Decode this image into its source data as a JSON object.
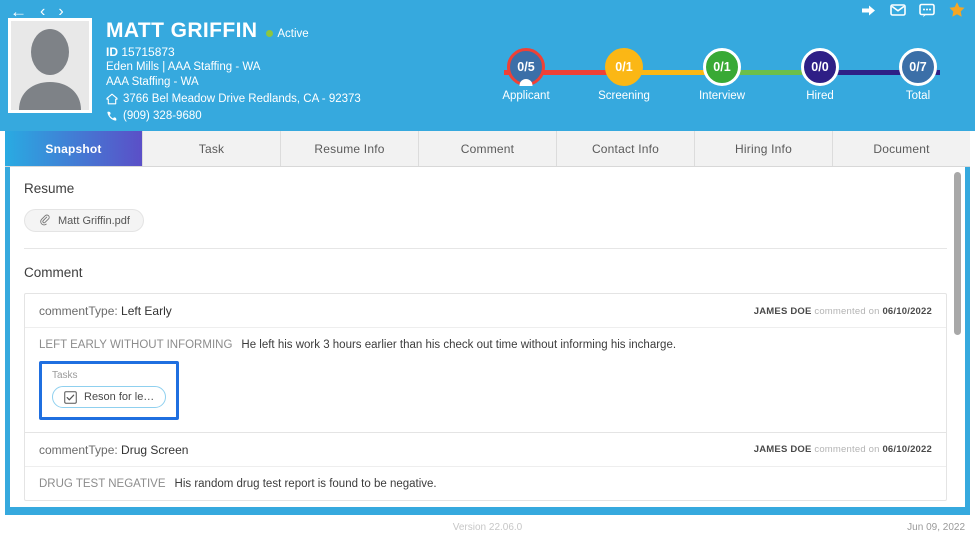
{
  "header": {
    "nav": {
      "back": "←",
      "prev": "‹",
      "next": "›"
    },
    "actions": [
      {
        "name": "forward-icon",
        "label": "Forward"
      },
      {
        "name": "mail-icon",
        "label": "Mail"
      },
      {
        "name": "chat-icon",
        "label": "Chat"
      },
      {
        "name": "star-icon",
        "label": "Favorite"
      }
    ],
    "background_color": "#36a9de",
    "star_color": "#f5a623"
  },
  "profile": {
    "name": "MATT GRIFFIN",
    "status": "Active",
    "status_color": "#8dc63f",
    "id_label": "ID",
    "id_value": "15715873",
    "branch": "Eden Mills | AAA Staffing - WA",
    "company": "AAA Staffing - WA",
    "address": "3766 Bel Meadow Drive Redlands, CA - 92373",
    "phone": "(909) 328-9680"
  },
  "pipeline": {
    "stages": [
      {
        "label": "Applicant",
        "count": "0/5",
        "color": "#ef4136",
        "style": "ring"
      },
      {
        "label": "Screening",
        "count": "0/1",
        "color": "#fbb715",
        "style": "fill"
      },
      {
        "label": "Interview",
        "count": "0/1",
        "color": "#39a935",
        "style": "fill"
      },
      {
        "label": "Hired",
        "count": "0/0",
        "color": "#2e1f86",
        "style": "fill"
      },
      {
        "label": "Total",
        "count": "0/7",
        "color": "#ffffff",
        "style": "ring-white"
      }
    ],
    "connectors": [
      "#ef4136",
      "#fbb715",
      "#6cbf4b",
      "#2e1f86"
    ]
  },
  "tabs": [
    {
      "label": "Snapshot",
      "active": true
    },
    {
      "label": "Task",
      "active": false
    },
    {
      "label": "Resume Info",
      "active": false
    },
    {
      "label": "Comment",
      "active": false
    },
    {
      "label": "Contact Info",
      "active": false
    },
    {
      "label": "Hiring Info",
      "active": false
    },
    {
      "label": "Document",
      "active": false
    }
  ],
  "resume": {
    "section_title": "Resume",
    "file_name": "Matt Griffin.pdf"
  },
  "comment_section": {
    "section_title": "Comment",
    "comments": [
      {
        "type_label": "commentType:",
        "type_value": "Left Early",
        "author": "JAMES DOE",
        "meta_mid": " commented on ",
        "date": "06/10/2022",
        "tag": "LEFT EARLY WITHOUT INFORMING",
        "text": "He left his work 3 hours earlier than his check out time without informing his incharge.",
        "tasks": {
          "label": "Tasks",
          "items": [
            "Reson for le…"
          ]
        }
      },
      {
        "type_label": "commentType:",
        "type_value": "Drug Screen",
        "author": "JAMES DOE",
        "meta_mid": " commented on ",
        "date": "06/10/2022",
        "tag": "DRUG TEST NEGATIVE",
        "text": "His random drug test report is found to be negative.",
        "tasks": null
      }
    ]
  },
  "footer": {
    "version": "Version 22.06.0",
    "date": "Jun 09, 2022"
  }
}
